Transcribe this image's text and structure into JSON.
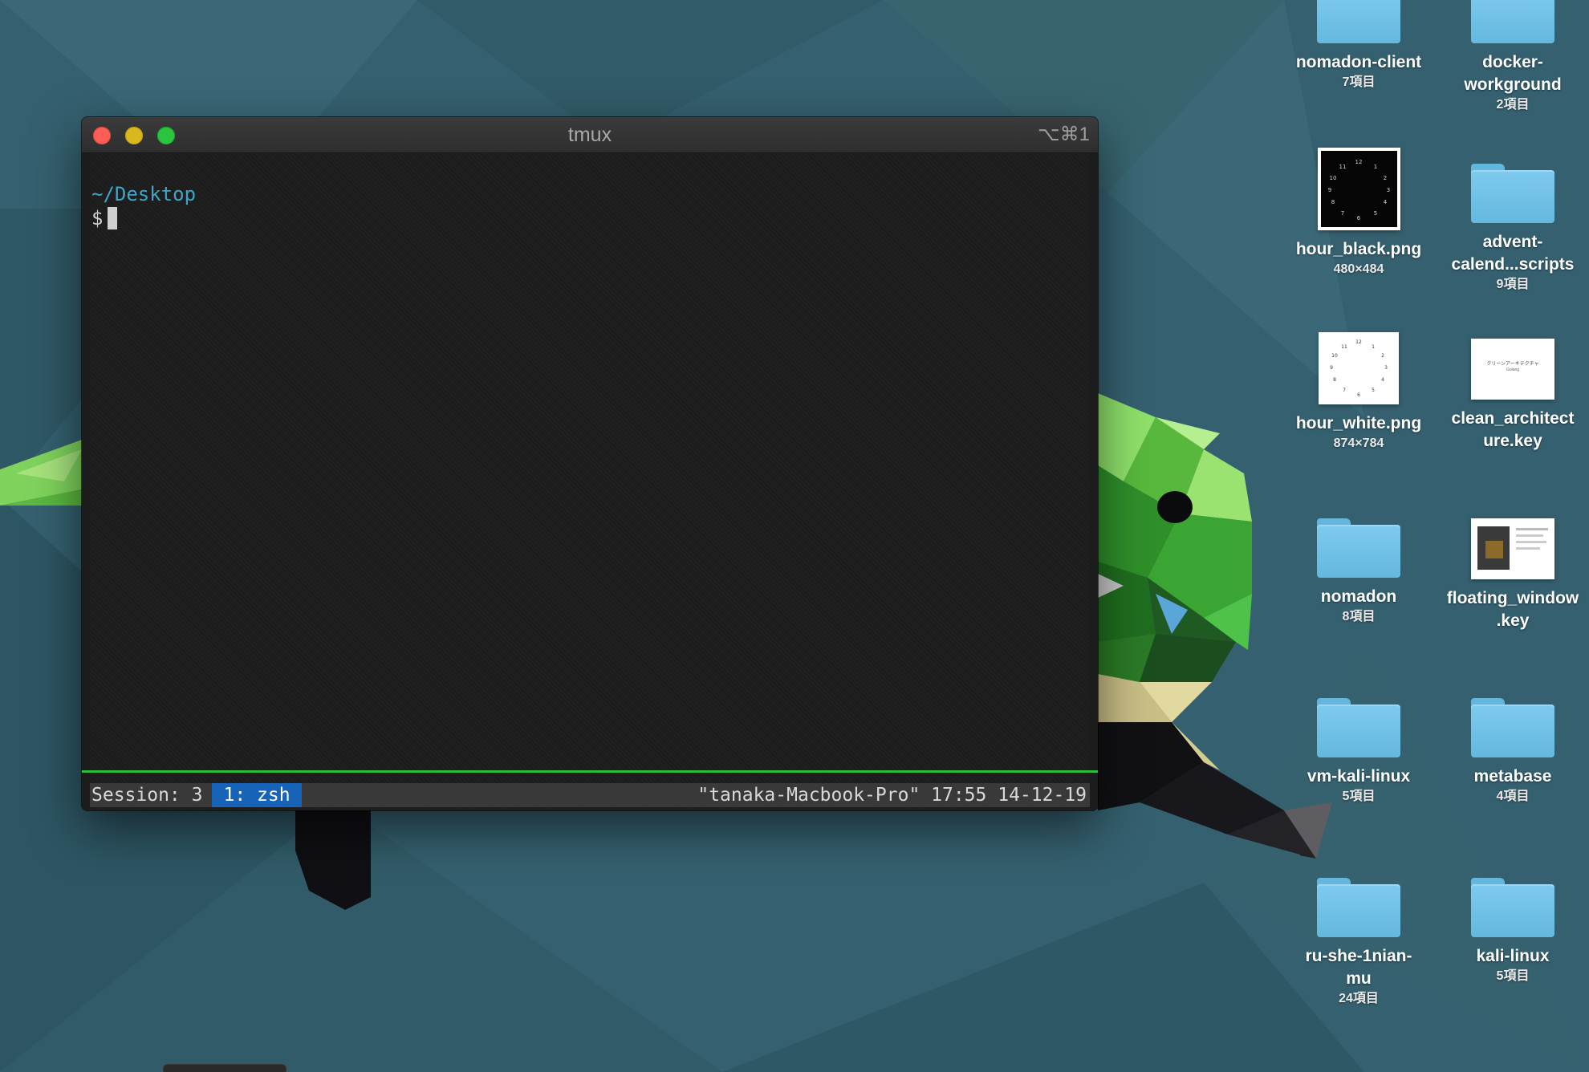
{
  "window": {
    "title": "tmux",
    "shortcut": "⌥⌘1"
  },
  "terminal": {
    "cwd": "~/Desktop",
    "prompt": "$"
  },
  "statusbar": {
    "session": "Session: 3",
    "window": "1: zsh",
    "right": "\"tanaka-Macbook-Pro\" 17:55 14-12-19"
  },
  "colors": {
    "accent_green": "#2dbb3a",
    "status_window_bg": "#1663b8",
    "cwd_color": "#3ea6c9",
    "folder_blue": "#7fcaee"
  },
  "desktop": {
    "items": [
      {
        "name": "nomadon-client",
        "info": "7項目",
        "icon": "folder-icon"
      },
      {
        "name": "docker-workground",
        "info": "2項目",
        "icon": "folder-icon"
      },
      {
        "name": "hour_black.png",
        "info": "480×484",
        "icon": "image-thumbnail"
      },
      {
        "name": "advent-calend...scripts",
        "info": "9項目",
        "icon": "folder-icon"
      },
      {
        "name": "hour_white.png",
        "info": "874×784",
        "icon": "image-thumbnail"
      },
      {
        "name": "clean_architecture.key",
        "info": "",
        "icon": "keynote-thumbnail",
        "thumb_title": "クリーンアーキテクチャ",
        "thumb_sub": "Golang"
      },
      {
        "name": "nomadon",
        "info": "8項目",
        "icon": "folder-icon"
      },
      {
        "name": "floating_window.key",
        "info": "",
        "icon": "keynote-thumbnail"
      },
      {
        "name": "vm-kali-linux",
        "info": "5項目",
        "icon": "folder-icon"
      },
      {
        "name": "metabase",
        "info": "4項目",
        "icon": "folder-icon"
      },
      {
        "name": "ru-she-1nian-mu",
        "info": "24項目",
        "icon": "folder-icon"
      },
      {
        "name": "kali-linux",
        "info": "5項目",
        "icon": "folder-icon"
      }
    ]
  }
}
